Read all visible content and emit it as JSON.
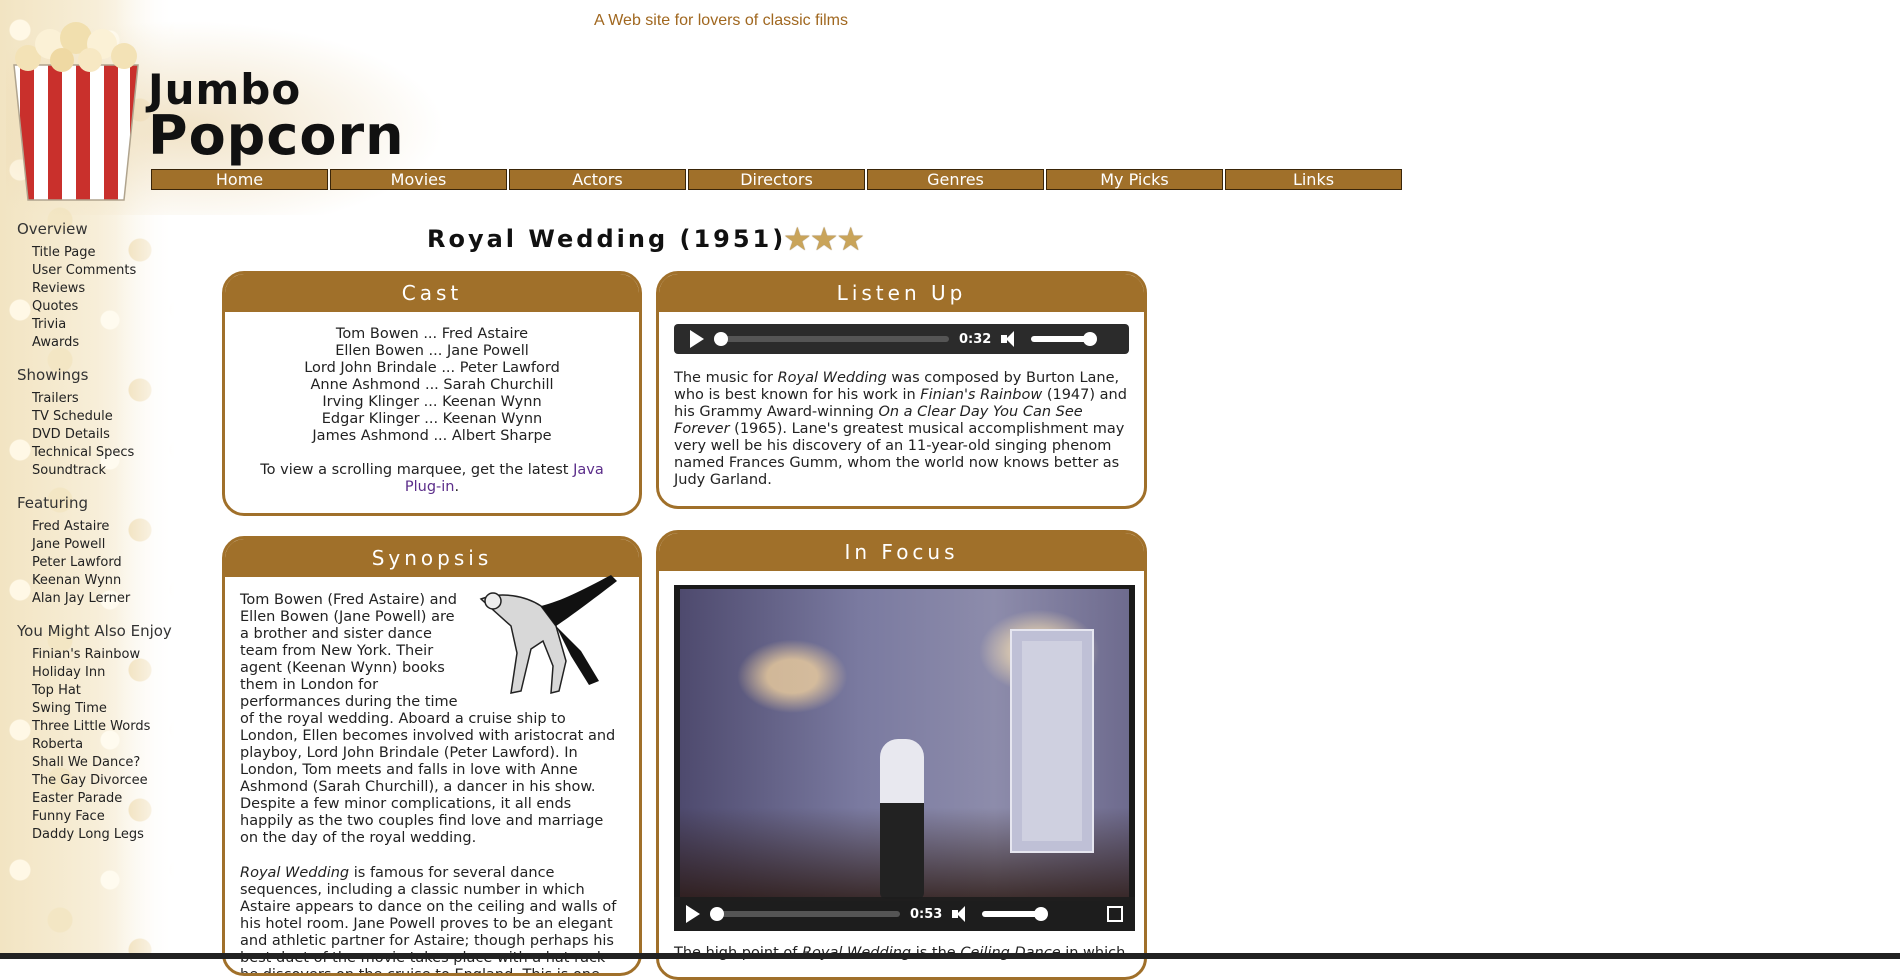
{
  "site": {
    "tagline": "A Web site for lovers of classic films",
    "logo_line1": "Jumbo",
    "logo_line2": "Popcorn"
  },
  "nav": [
    "Home",
    "Movies",
    "Actors",
    "Directors",
    "Genres",
    "My Picks",
    "Links"
  ],
  "sidebar": [
    {
      "heading": "Overview",
      "items": [
        "Title Page",
        "User Comments",
        "Reviews",
        "Quotes",
        "Trivia",
        "Awards"
      ]
    },
    {
      "heading": "Showings",
      "items": [
        "Trailers",
        "TV Schedule",
        "DVD Details",
        "Technical Specs",
        "Soundtrack"
      ]
    },
    {
      "heading": "Featuring",
      "items": [
        "Fred Astaire",
        "Jane Powell",
        "Peter Lawford",
        "Keenan Wynn",
        "Alan Jay Lerner"
      ]
    },
    {
      "heading": "You Might Also Enjoy",
      "items": [
        "Finian's Rainbow",
        "Holiday Inn",
        "Top Hat",
        "Swing Time",
        "Three Little Words",
        "Roberta",
        "Shall We Dance?",
        "The Gay Divorcee",
        "Easter Parade",
        "Funny Face",
        "Daddy Long Legs"
      ]
    }
  ],
  "page": {
    "title": "Royal Wedding (1951)",
    "rating": 3
  },
  "cast": {
    "heading": "Cast",
    "lines": [
      "Tom Bowen ... Fred Astaire",
      "Ellen Bowen ... Jane Powell",
      "Lord John Brindale ... Peter Lawford",
      "Anne Ashmond ... Sarah Churchill",
      "Irving Klinger ... Keenan Wynn",
      "Edgar Klinger ... Keenan Wynn",
      "James Ashmond ... Albert Sharpe"
    ],
    "marquee_text": "To view a scrolling marquee, get the latest",
    "marquee_link": "Java Plug-in",
    "marquee_end": "."
  },
  "listen": {
    "heading": "Listen Up",
    "time": "0:32",
    "progress": 0.04,
    "volume": 1.0,
    "p1": "The music for ",
    "i1": "Royal Wedding",
    "p2": " was composed by Burton Lane, who is best known for his work in ",
    "i2": "Finian's Rainbow",
    "p3": " (1947) and his Grammy Award-winning ",
    "i3": "On a Clear Day You Can See Forever",
    "p4": " (1965). Lane's greatest musical accomplishment may very well be his discovery of an 11-year-old singing phenom named Frances Gumm, whom the world now knows better as Judy Garland."
  },
  "synopsis": {
    "heading": "Synopsis",
    "para1": "Tom Bowen (Fred Astaire) and Ellen Bowen (Jane Powell) are a brother and sister dance team from New York. Their agent (Keenan Wynn) books them in London for performances during the time of the royal wedding. Aboard a cruise ship to London, Ellen becomes involved with aristocrat and playboy, Lord John Brindale (Peter Lawford). In London, Tom meets and falls in love with Anne Ashmond (Sarah Churchill), a dancer in his show. Despite a few minor complications, it all ends happily as the two couples find love and marriage on the day of the royal wedding.",
    "para2_i": "Royal Wedding",
    "para2": " is famous for several dance sequences, including a classic number in which Astaire appears to dance on the ceiling and walls of his hotel room. Jane Powell proves to be an elegant and athletic partner for Astaire; though perhaps his best duet of the movie takes place with a hat rack he discovers on the cruise to England. This is one"
  },
  "focus": {
    "heading": "In Focus",
    "time": "0:53",
    "progress": 0.05,
    "volume": 1.0,
    "caption_start": "The high point of ",
    "caption_i1": "Royal Wedding",
    "caption_mid": " is the ",
    "caption_i2": "Ceiling Dance",
    "caption_end": " in which"
  },
  "colors": {
    "accent": "#a0702a",
    "link": "#5b2d8a",
    "tagline": "#a0671f"
  }
}
